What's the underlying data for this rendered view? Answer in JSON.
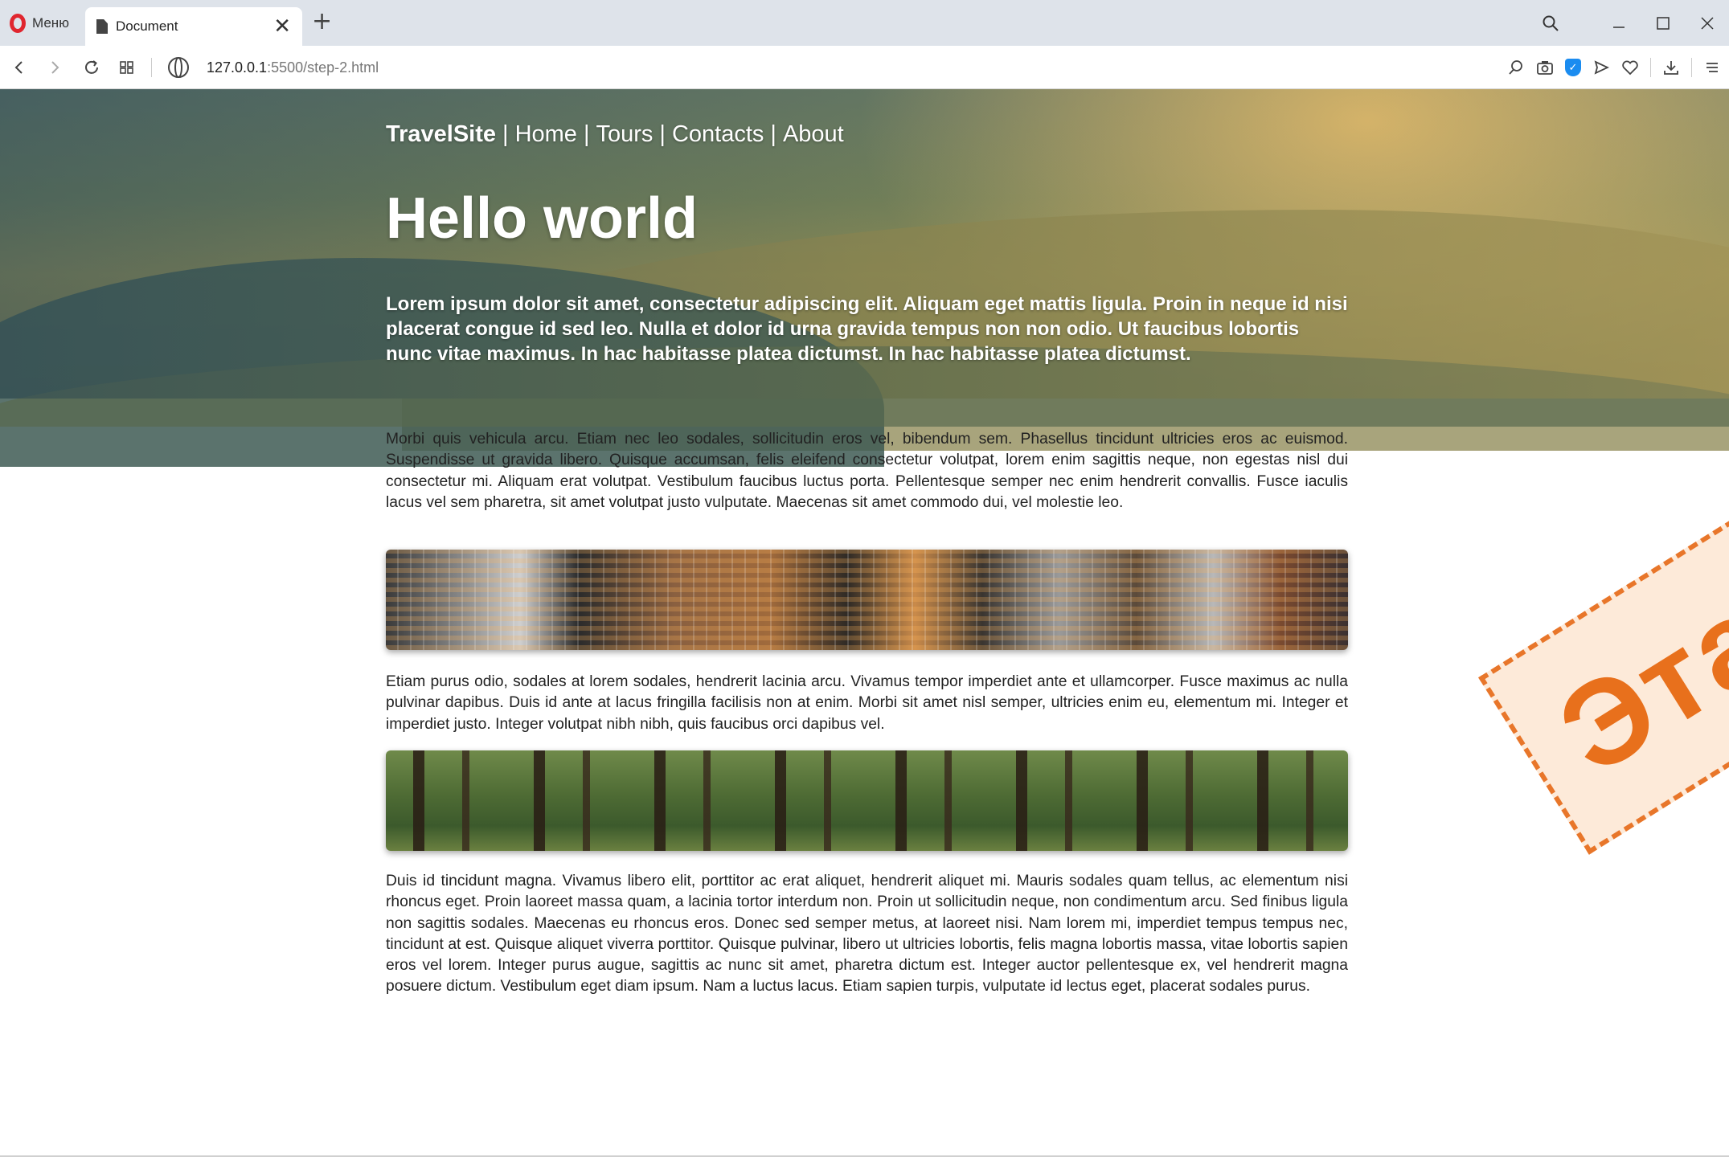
{
  "browser": {
    "menu_label": "Меню",
    "tab_title": "Document",
    "url_host": "127.0.0.1",
    "url_path": ":5500/step-2.html"
  },
  "site": {
    "nav": {
      "brand": "TravelSite",
      "separator": "|",
      "items": [
        "Home",
        "Tours",
        "Contacts",
        "About"
      ]
    },
    "hero": {
      "title": "Hello world",
      "lead": "Lorem ipsum dolor sit amet, consectetur adipiscing elit. Aliquam eget mattis ligula. Proin in neque id nisi placerat congue id sed leo. Nulla et dolor id urna gravida tempus non non odio. Ut faucibus lobortis nunc vitae maximus. In hac habitasse platea dictumst. In hac habitasse platea dictumst."
    },
    "paragraphs": [
      "Morbi quis vehicula arcu. Etiam nec leo sodales, sollicitudin eros vel, bibendum sem. Phasellus tincidunt ultricies eros ac euismod. Suspendisse ut gravida libero. Quisque accumsan, felis eleifend consectetur volutpat, lorem enim sagittis neque, non egestas nisl dui consectetur mi. Aliquam erat volutpat. Vestibulum faucibus luctus porta. Pellentesque semper nec enim hendrerit convallis. Fusce iaculis lacus vel sem pharetra, sit amet volutpat justo vulputate. Maecenas sit amet commodo dui, vel molestie leo.",
      "Etiam purus odio, sodales at lorem sodales, hendrerit lacinia arcu. Vivamus tempor imperdiet ante et ullamcorper. Fusce maximus ac nulla pulvinar dapibus. Duis id ante at lacus fringilla facilisis non at enim. Morbi sit amet nisl semper, ultricies enim eu, elementum mi. Integer et imperdiet justo. Integer volutpat nibh nibh, quis faucibus orci dapibus vel.",
      "Duis id tincidunt magna. Vivamus libero elit, porttitor ac erat aliquet, hendrerit aliquet mi. Mauris sodales quam tellus, ac elementum nisi rhoncus eget. Proin laoreet massa quam, a lacinia tortor interdum non. Proin ut sollicitudin neque, non condimentum arcu. Sed finibus ligula non sagittis sodales. Maecenas eu rhoncus eros. Donec sed semper metus, at laoreet nisi. Nam lorem mi, imperdiet tempus tempus nec, tincidunt at est. Quisque aliquet viverra porttitor. Quisque pulvinar, libero ut ultricies lobortis, felis magna lobortis massa, vitae lobortis sapien eros vel lorem. Integer purus augue, sagittis ac nunc sit amet, pharetra dictum est. Integer auctor pellentesque ex, vel hendrerit magna posuere dictum. Vestibulum eget diam ipsum. Nam a luctus lacus. Etiam sapien turpis, vulputate id lectus eget, placerat sodales purus."
    ],
    "stamp_text": "Этап"
  },
  "icons": {
    "browser_logo": "opera-logo-icon",
    "tab": "document-icon",
    "close_tab": "close-icon",
    "new_tab": "plus-icon",
    "back": "back-arrow-icon",
    "forward": "forward-arrow-icon",
    "reload": "reload-icon",
    "speed_dial": "grid-icon",
    "site_info": "globe-icon",
    "toolbar": [
      "search-icon",
      "camera-icon",
      "shield-icon",
      "send-icon",
      "heart-icon",
      "download-icon",
      "menu-icon"
    ]
  },
  "colors": {
    "stamp": "#e8701c",
    "opera": "#e0262f",
    "shield": "#1b8cf0"
  }
}
